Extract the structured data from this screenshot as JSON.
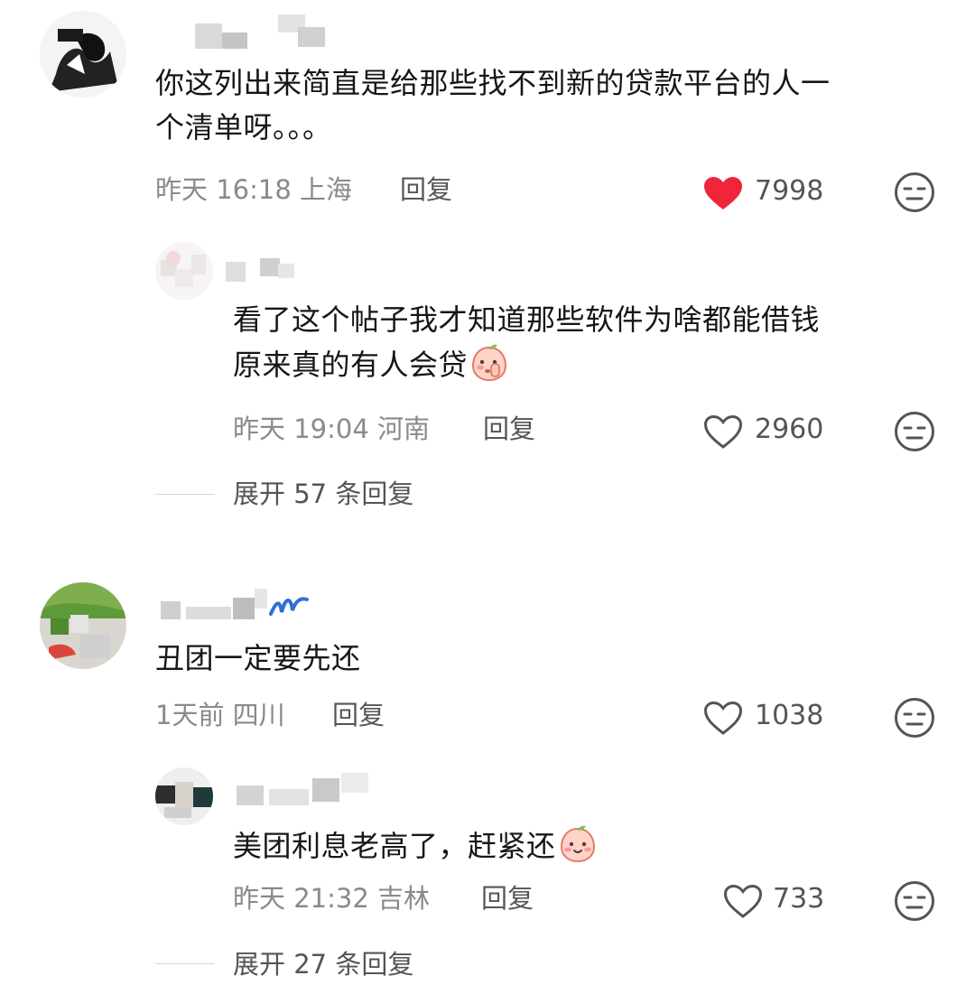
{
  "comments": [
    {
      "text": "你这列出来简直是给那些找不到新的贷款平台的人一个清单呀。。。",
      "text_line1": "你这列出来简直是给那些找不到新的贷款平台的人一",
      "text_line2": "个清单呀。。。",
      "meta": "昨天 16:18 上海",
      "reply_label": "回复",
      "likes": "7998",
      "liked": true,
      "like_icon": "heart-filled-icon",
      "dislike_icon": "unamused-face-icon",
      "replies": [
        {
          "text_line1": "看了这个帖子我才知道那些软件为啥都能借钱",
          "text_line2": "原来真的有人会贷",
          "emoji": "peach-shush-emoji",
          "meta": "昨天 19:04 河南",
          "reply_label": "回复",
          "likes": "2960",
          "liked": false
        }
      ],
      "expand_label": "展开 57 条回复"
    },
    {
      "text_line1": "丑团一定要先还",
      "meta": "1天前 四川",
      "reply_label": "回复",
      "likes": "1038",
      "liked": false,
      "replies": [
        {
          "text_line1": "美团利息老高了，赶紧还",
          "emoji": "peach-smile-emoji",
          "meta": "昨天 21:32 吉林",
          "reply_label": "回复",
          "likes": "733",
          "liked": false
        }
      ],
      "expand_label": "展开 27 条回复"
    }
  ],
  "colors": {
    "heart_red": "#f0253b",
    "meta_gray": "#8a8a8a",
    "text": "#161616"
  }
}
